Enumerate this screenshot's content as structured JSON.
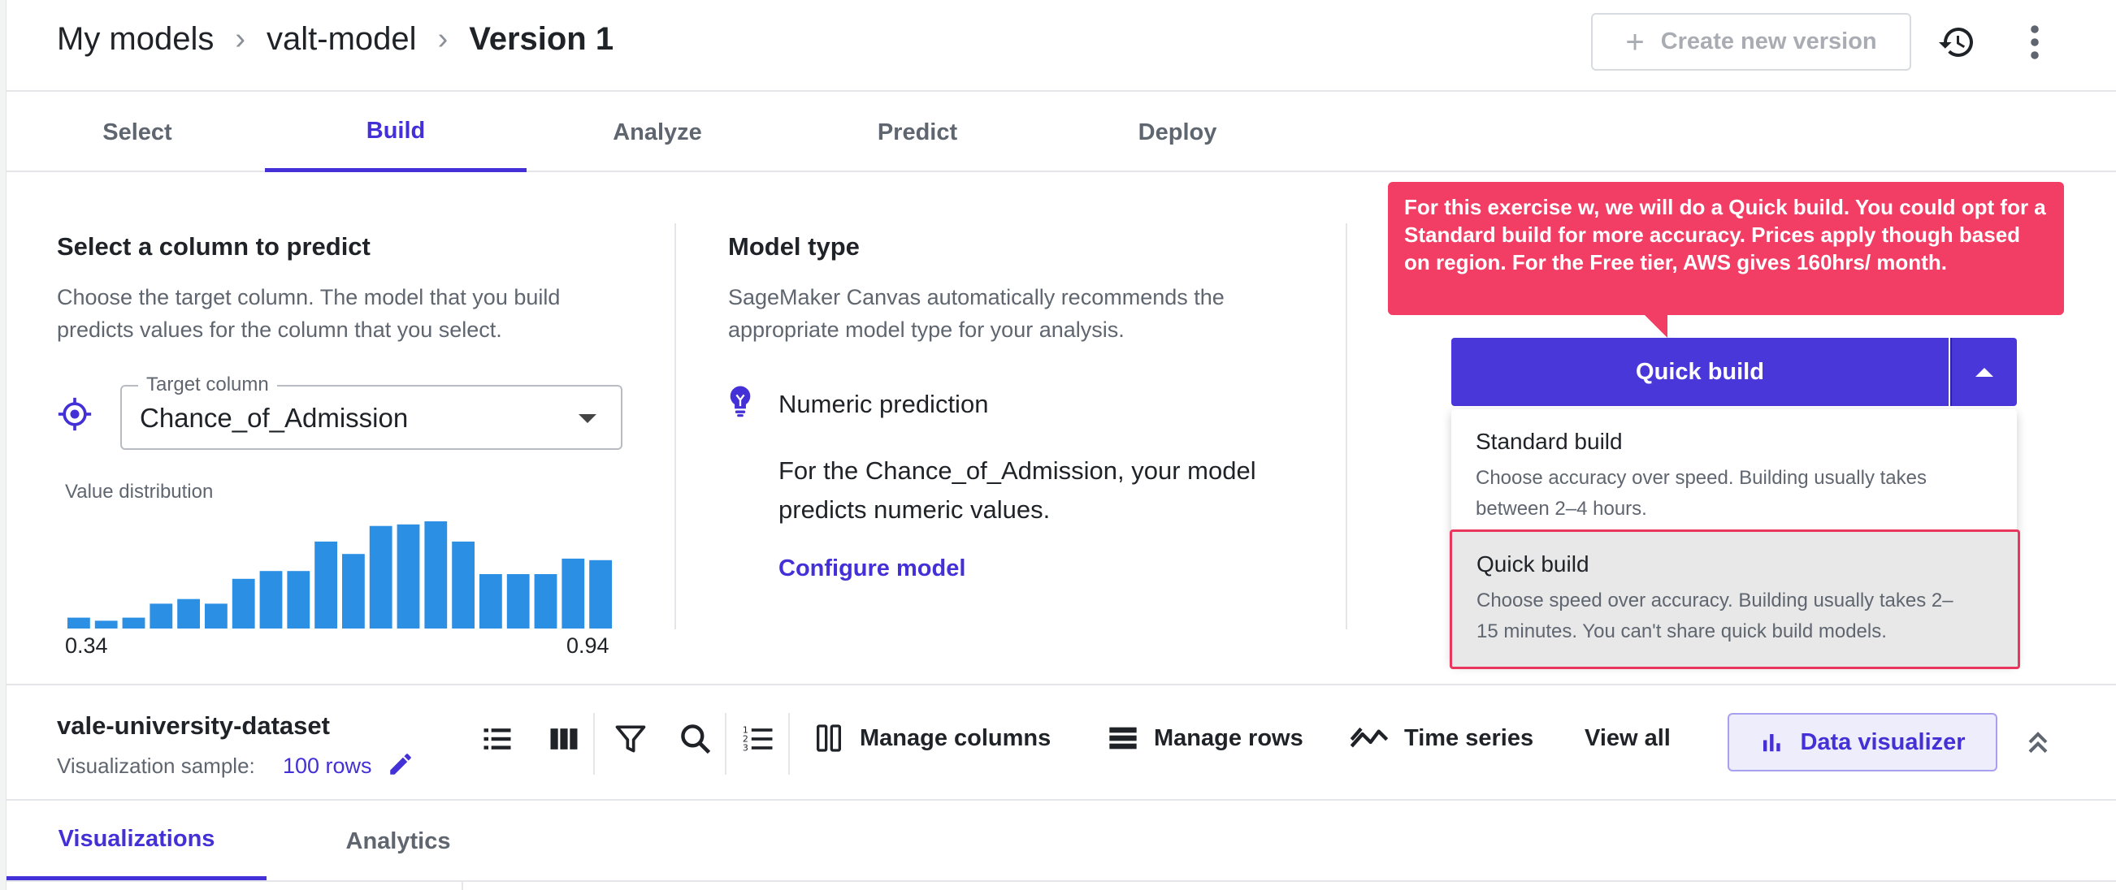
{
  "breadcrumb": {
    "root": "My models",
    "model": "valt-model",
    "current": "Version 1"
  },
  "header": {
    "create_label": "Create new version",
    "create_plus": "+"
  },
  "tabs": [
    "Select",
    "Build",
    "Analyze",
    "Predict",
    "Deploy"
  ],
  "active_tab": "Build",
  "target_panel": {
    "title": "Select a column to predict",
    "desc_line1": "Choose the target column. The model that you build",
    "desc_line2": "predicts values for the column that you select.",
    "field_legend": "Target column",
    "field_value": "Chance_of_Admission",
    "dist_label": "Value distribution",
    "axis_min": "0.34",
    "axis_max": "0.94"
  },
  "chart_data": {
    "type": "bar",
    "title": "Value distribution",
    "xlim": [
      0.34,
      0.94
    ],
    "values": [
      7,
      5,
      7,
      16,
      19,
      16,
      32,
      37,
      37,
      56,
      48,
      66,
      67,
      69,
      56,
      35,
      35,
      35,
      45,
      44
    ],
    "bar_color": "#2b8fe4"
  },
  "model_panel": {
    "title": "Model type",
    "desc_line1": "SageMaker Canvas automatically recommends the",
    "desc_line2": "appropriate model type for your analysis.",
    "type_name": "Numeric prediction",
    "type_desc_line1": "For the Chance_of_Admission, your model",
    "type_desc_line2": "predicts numeric values.",
    "configure_link": "Configure model"
  },
  "tooltip": {
    "text": "For this exercise w, we will do a Quick build. You could opt for a Standard build for more accuracy. Prices apply though based on region. For the Free tier, AWS gives 160hrs/ month."
  },
  "build": {
    "button_label": "Quick build",
    "options": [
      {
        "title": "Standard build",
        "desc_line1": "Choose accuracy over speed. Building usually takes",
        "desc_line2": "between 2–4 hours."
      },
      {
        "title": "Quick build",
        "desc_line1": "Choose speed over accuracy. Building usually takes 2–",
        "desc_line2": "15 minutes. You can't share quick build models."
      }
    ],
    "selected_option": "Quick build"
  },
  "dataset": {
    "name": "vale-university-dataset",
    "sample_label": "Visualization sample:",
    "sample_value": "100 rows"
  },
  "toolbar": {
    "manage_columns": "Manage columns",
    "manage_rows": "Manage rows",
    "time_series": "Time series",
    "view_all": "View all",
    "data_visualizer": "Data visualizer"
  },
  "bottom_tabs": [
    "Visualizations",
    "Analytics"
  ],
  "colors": {
    "accent": "#4330d6",
    "tooltip": "#f23d64",
    "bar": "#2b8fe4"
  }
}
